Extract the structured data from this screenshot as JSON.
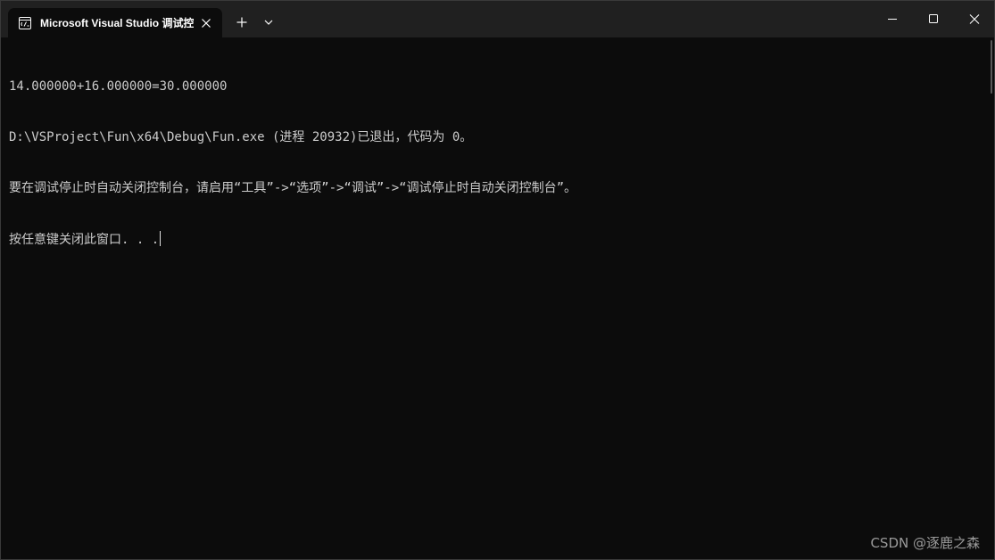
{
  "titlebar": {
    "tab_title": "Microsoft Visual Studio 调试控制台",
    "tab_icon": "console-app-icon",
    "close_tab_icon": "close-icon",
    "new_tab_label": "+",
    "new_tab_icon": "plus-icon",
    "dropdown_icon": "chevron-down-icon",
    "window_controls": [
      "minimize-icon",
      "maximize-icon",
      "close-icon"
    ]
  },
  "console": {
    "lines": [
      "14.000000+16.000000=30.000000",
      "D:\\VSProject\\Fun\\x64\\Debug\\Fun.exe (进程 20932)已退出，代码为 0。",
      "要在调试停止时自动关闭控制台，请启用“工具”->“选项”->“调试”->“调试停止时自动关闭控制台”。",
      "按任意键关闭此窗口. . ."
    ]
  },
  "watermark": "CSDN @逐鹿之森",
  "colors": {
    "titlebar_bg": "#202020",
    "console_bg": "#0c0c0c",
    "console_text": "#cccccc"
  }
}
